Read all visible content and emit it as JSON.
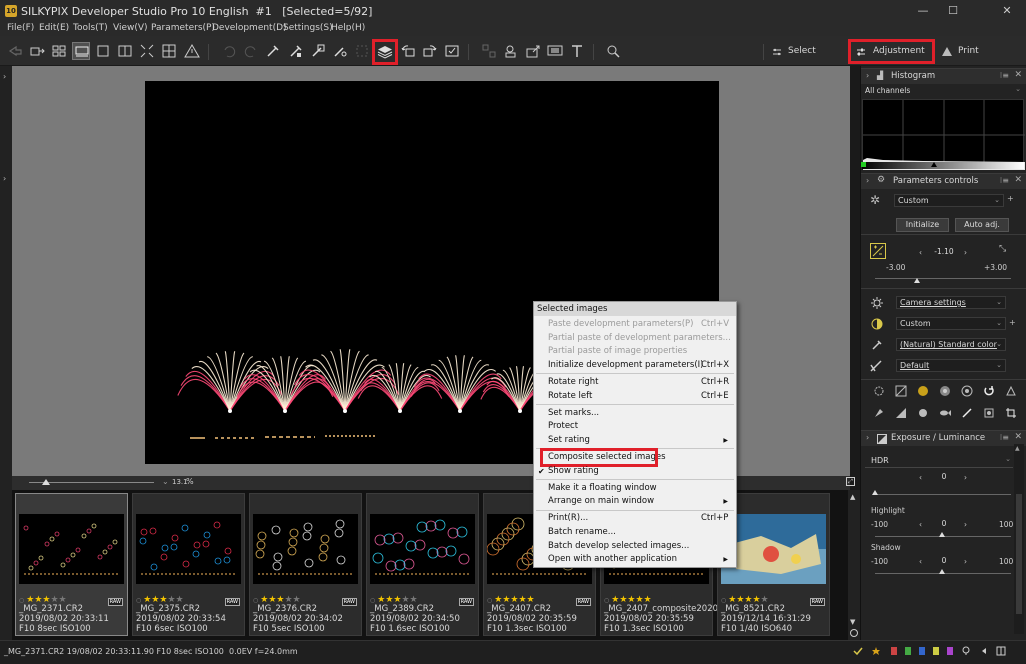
{
  "window": {
    "icon_text": "10",
    "title": "SILKYPIX Developer Studio Pro 10 English  #1   [Selected=5/92]",
    "minimize": "—",
    "maximize": "☐",
    "close": "✕"
  },
  "menu": [
    "File(F)",
    "Edit(E)",
    "Tools(T)",
    "View(V)",
    "Parameters(P)",
    "Development(D)",
    "Settings(S)",
    "Help(H)"
  ],
  "toolbar": {
    "mode_select": "Select",
    "mode_adjustment": "Adjustment",
    "mode_print": "Print",
    "highlighted_tool": "composite-layers-icon"
  },
  "preview": {
    "zoom_value": "13.1",
    "zoom_unit": "%"
  },
  "thumbnails": [
    {
      "stars": 3,
      "name": "_MG_2371.CR2",
      "date": "2019/08/02 20:33:11",
      "exif": "F10 8sec ISO100",
      "raw": "RAW",
      "selected": true
    },
    {
      "stars": 3,
      "name": "_MG_2375.CR2",
      "date": "2019/08/02 20:33:54",
      "exif": "F10 6sec ISO100",
      "raw": "RAW",
      "selected": false
    },
    {
      "stars": 3,
      "name": "_MG_2376.CR2",
      "date": "2019/08/02 20:34:02",
      "exif": "F10 5sec ISO100",
      "raw": "RAW",
      "selected": false
    },
    {
      "stars": 3,
      "name": "_MG_2389.CR2",
      "date": "2019/08/02 20:34:50",
      "exif": "F10 1.6sec ISO100",
      "raw": "RAW",
      "selected": false
    },
    {
      "stars": 5,
      "name": "_MG_2407.CR2",
      "date": "2019/08/02 20:35:59",
      "exif": "F10 1.3sec ISO100",
      "raw": "RAW",
      "selected": false
    },
    {
      "stars": 5,
      "name": "_MG_2407_composite2020",
      "date": "2019/08/02 20:35:59",
      "exif": "F10 1.3sec ISO100",
      "raw": "",
      "selected": false
    },
    {
      "stars": 4,
      "name": "_MG_8521.CR2",
      "date": "2019/12/14 16:31:29",
      "exif": "F10 1/40 ISO640",
      "raw": "RAW",
      "selected": false
    }
  ],
  "status": {
    "text": "_MG_2371.CR2 19/08/02 20:33:11.90 F10 8sec ISO100  0.0EV f=24.0mm"
  },
  "context_menu": {
    "title": "Selected images",
    "items": [
      {
        "label": "Paste development parameters(P)",
        "shortcut": "Ctrl+V",
        "disabled": true
      },
      {
        "label": "Partial paste of development parameters...",
        "shortcut": "",
        "disabled": true
      },
      {
        "label": "Partial paste of image properties",
        "shortcut": "",
        "disabled": true
      },
      {
        "label": "Initialize development parameters(I)",
        "shortcut": "Ctrl+X",
        "disabled": false
      },
      {
        "label": "Rotate right",
        "shortcut": "Ctrl+R",
        "disabled": false
      },
      {
        "label": "Rotate left",
        "shortcut": "Ctrl+E",
        "disabled": false
      },
      {
        "label": "Set marks...",
        "shortcut": "",
        "disabled": false
      },
      {
        "label": "Protect",
        "shortcut": "",
        "disabled": false
      },
      {
        "label": "Set rating",
        "shortcut": "",
        "disabled": false,
        "submenu": true
      },
      {
        "label": "Composite selected images",
        "shortcut": "",
        "disabled": false,
        "highlighted": true
      },
      {
        "label": "Show rating",
        "shortcut": "",
        "disabled": false,
        "checked": true
      },
      {
        "label": "Make it a floating window",
        "shortcut": "",
        "disabled": false
      },
      {
        "label": "Arrange on main window",
        "shortcut": "",
        "disabled": false,
        "submenu": true
      },
      {
        "label": "Print(R)...",
        "shortcut": "Ctrl+P",
        "disabled": false
      },
      {
        "label": "Batch rename...",
        "shortcut": "",
        "disabled": false
      },
      {
        "label": "Batch develop selected images...",
        "shortcut": "",
        "disabled": false
      },
      {
        "label": "Open with another application",
        "shortcut": "",
        "disabled": false,
        "submenu": true
      }
    ]
  },
  "right_panel": {
    "histogram": {
      "title": "Histogram",
      "channel": "All channels"
    },
    "params": {
      "title": "Parameters controls",
      "taste": "Custom",
      "initialize": "Initialize",
      "auto_adj": "Auto adj.",
      "exposure_value": "-1.10",
      "exposure_min": "-3.00",
      "exposure_max": "+3.00",
      "exposure_level": 0.32,
      "wb": "Camera settings",
      "tone": "Custom",
      "color": "(Natural) Standard color",
      "sharp": "Default"
    },
    "exposure_lum": {
      "title": "Exposure / Luminance",
      "mode": "HDR",
      "hdr_value": "0",
      "highlight_label": "Highlight",
      "highlight_value": "0",
      "highlight_min": "-100",
      "highlight_max": "100",
      "shadow_label": "Shadow",
      "shadow_value": "0",
      "shadow_min": "-100",
      "shadow_max": "100"
    }
  },
  "colors": {
    "accent_red": "#e0202a",
    "star_yellow": "#f2c300"
  }
}
